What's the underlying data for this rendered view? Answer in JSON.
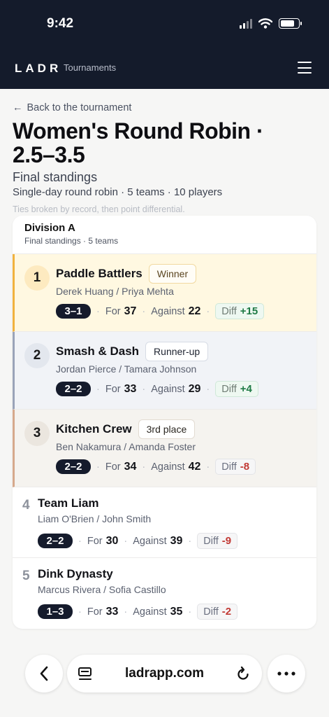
{
  "status_bar": {
    "time": "9:42"
  },
  "header": {
    "brand": "LADR",
    "nav_link": "Tournaments"
  },
  "page": {
    "back_link": "Back to the tournament",
    "title": "Women's Round Robin · 2.5–3.5",
    "subtitle": "Final standings",
    "meta": "Single-day round robin · 5 teams · 10 players",
    "note": "Ties broken by record, then point differential."
  },
  "division": {
    "name": "Division A",
    "sub": "Final standings · 5 teams",
    "rows": [
      {
        "rank": "1",
        "team": "Paddle Battlers",
        "badge": "Winner",
        "players": "Derek Huang / Priya Mehta",
        "record": "3–1",
        "for_label": "For",
        "for": "37",
        "against_label": "Against",
        "against": "22",
        "diff_label": "Diff",
        "diff": "+15"
      },
      {
        "rank": "2",
        "team": "Smash & Dash",
        "badge": "Runner-up",
        "players": "Jordan Pierce / Tamara Johnson",
        "record": "2–2",
        "for_label": "For",
        "for": "33",
        "against_label": "Against",
        "against": "29",
        "diff_label": "Diff",
        "diff": "+4"
      },
      {
        "rank": "3",
        "team": "Kitchen Crew",
        "badge": "3rd place",
        "players": "Ben Nakamura / Amanda Foster",
        "record": "2–2",
        "for_label": "For",
        "for": "34",
        "against_label": "Against",
        "against": "42",
        "diff_label": "Diff",
        "diff": "-8"
      },
      {
        "rank": "4",
        "team": "Team Liam",
        "players": "Liam O'Brien / John Smith",
        "record": "2–2",
        "for_label": "For",
        "for": "30",
        "against_label": "Against",
        "against": "39",
        "diff_label": "Diff",
        "diff": "-9"
      },
      {
        "rank": "5",
        "team": "Dink Dynasty",
        "players": "Marcus Rivera / Sofia Castillo",
        "record": "1–3",
        "for_label": "For",
        "for": "33",
        "against_label": "Against",
        "against": "35",
        "diff_label": "Diff",
        "diff": "-2"
      }
    ]
  },
  "browser": {
    "url": "ladrapp.com"
  },
  "colors": {
    "header_bg": "#141b2b",
    "gold_bg": "#fff8e1",
    "gold_accent": "#f1b23e",
    "silver_bg": "#f1f3f7",
    "silver_accent": "#9aa3b8",
    "bronze_bg": "#f5f3ef",
    "bronze_accent": "#d6a98c",
    "positive": "#1f7a45",
    "negative": "#c23a35"
  },
  "icons": [
    "signal-icon",
    "wifi-icon",
    "battery-icon",
    "menu-icon",
    "back-arrow-icon",
    "chevron-left-icon",
    "tabs-icon",
    "reload-icon",
    "more-icon"
  ]
}
